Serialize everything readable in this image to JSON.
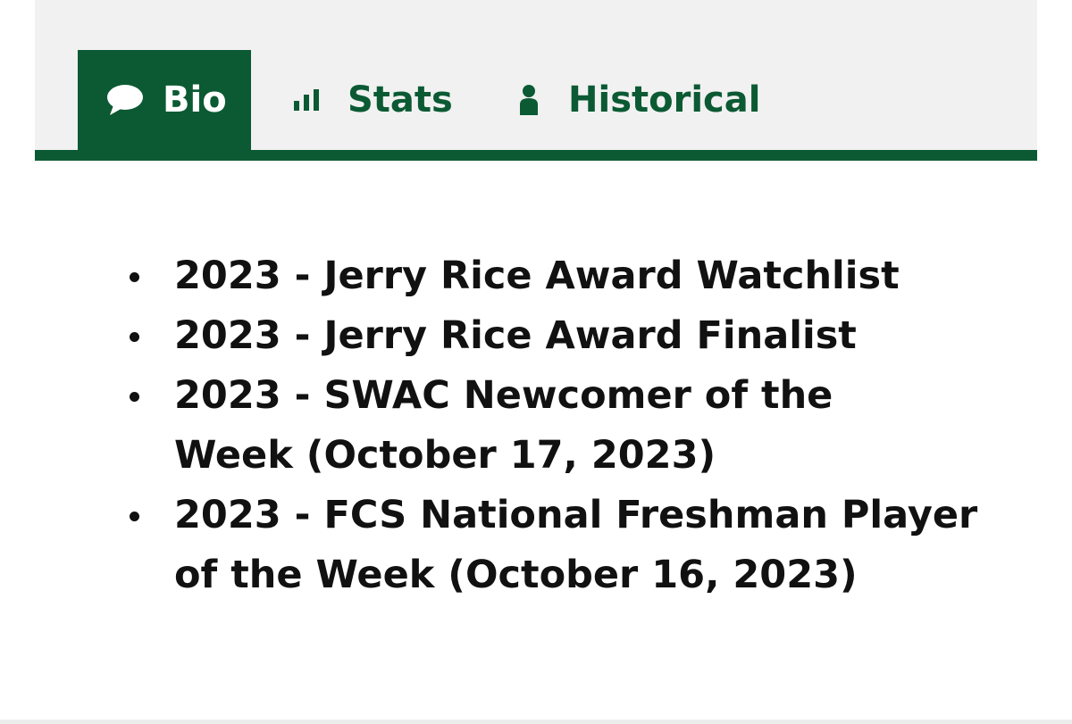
{
  "tabs": {
    "bio": {
      "label": "Bio",
      "icon": "comment-icon",
      "active": true
    },
    "stats": {
      "label": "Stats",
      "icon": "bar-chart-icon",
      "active": false
    },
    "historical": {
      "label": "Historical",
      "icon": "person-icon",
      "active": false
    }
  },
  "honors": [
    {
      "line1": "2023 - Jerry Rice Award Watchlist",
      "line2": ""
    },
    {
      "line1": "2023 - Jerry Rice Award Finalist",
      "line2": ""
    },
    {
      "line1": "2023 - SWAC Newcomer of the",
      "line2": "Week (October 17, 2023)"
    },
    {
      "line1": "2023 - FCS National Freshman Player",
      "line2": "of the Week (October 16, 2023)"
    }
  ],
  "colors": {
    "accent": "#0b5a33",
    "tab_strip_background": "#f1f1f1",
    "text": "#111111"
  }
}
